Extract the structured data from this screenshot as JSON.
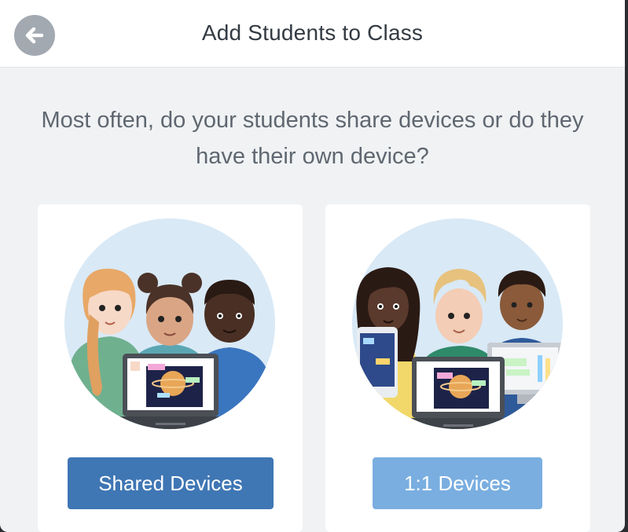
{
  "header": {
    "title": "Add Students to Class",
    "back_icon": "arrow-left-icon"
  },
  "prompt": {
    "question": "Most often, do your students share devices or do they have their own device?"
  },
  "options": [
    {
      "label": "Shared Devices",
      "illustration": "three students sharing one laptop",
      "button_color": "#3f76b4"
    },
    {
      "label": "1:1 Devices",
      "illustration": "three students each with their own device",
      "button_color": "#7aaee0"
    }
  ],
  "colors": {
    "background": "#f0f2f4",
    "circle_bg": "#d9e9f6",
    "primary": "#3f76b4",
    "primary_light": "#7aaee0"
  }
}
